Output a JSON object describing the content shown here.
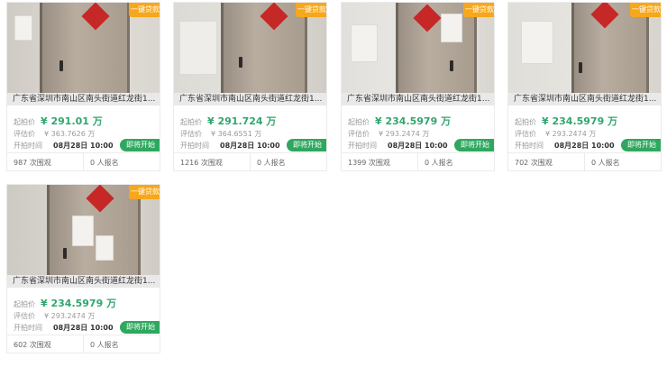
{
  "labels": {
    "start_price": "起拍价",
    "estimate": "评估价",
    "start_time": "开拍时间",
    "badge": "一键贷款",
    "soon": "即将开始"
  },
  "listings": [
    {
      "address": "广东省深圳市南山区南头街道红龙街1...",
      "start_price": "¥ 291.01 万",
      "estimate": "¥ 363.7626 万",
      "start_time": "08月28日 10:00",
      "views": "987 次围观",
      "signups": "0 人报名"
    },
    {
      "address": "广东省深圳市南山区南头街道红龙街1...",
      "start_price": "¥ 291.724 万",
      "estimate": "¥ 364.6551 万",
      "start_time": "08月28日 10:00",
      "views": "1216 次围观",
      "signups": "0 人报名"
    },
    {
      "address": "广东省深圳市南山区南头街道红龙街1...",
      "start_price": "¥ 234.5979 万",
      "estimate": "¥ 293.2474 万",
      "start_time": "08月28日 10:00",
      "views": "1399 次围观",
      "signups": "0 人报名"
    },
    {
      "address": "广东省深圳市南山区南头街道红龙街1...",
      "start_price": "¥ 234.5979 万",
      "estimate": "¥ 293.2474 万",
      "start_time": "08月28日 10:00",
      "views": "702 次围观",
      "signups": "0 人报名"
    },
    {
      "address": "广东省深圳市南山区南头街道红龙街1...",
      "start_price": "¥ 234.5979 万",
      "estimate": "¥ 293.2474 万",
      "start_time": "08月28日 10:00",
      "views": "602 次围观",
      "signups": "0 人报名"
    }
  ]
}
